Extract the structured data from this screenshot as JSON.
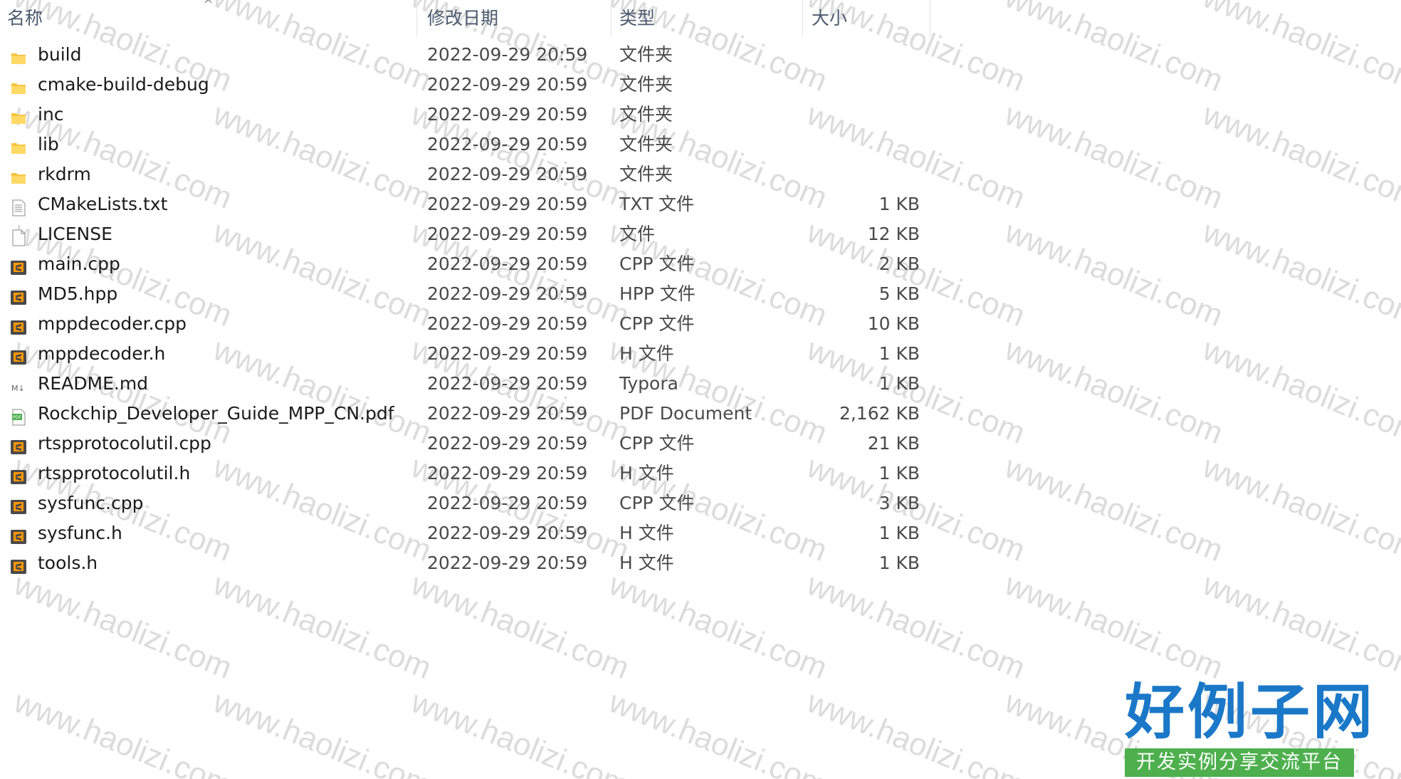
{
  "columns": {
    "name": "名称",
    "modified": "修改日期",
    "type": "类型",
    "size": "大小"
  },
  "files": [
    {
      "name": "build",
      "modified": "2022-09-29 20:59",
      "type": "文件夹",
      "size": "",
      "icon": "folder-icon"
    },
    {
      "name": "cmake-build-debug",
      "modified": "2022-09-29 20:59",
      "type": "文件夹",
      "size": "",
      "icon": "folder-icon"
    },
    {
      "name": "inc",
      "modified": "2022-09-29 20:59",
      "type": "文件夹",
      "size": "",
      "icon": "folder-icon"
    },
    {
      "name": "lib",
      "modified": "2022-09-29 20:59",
      "type": "文件夹",
      "size": "",
      "icon": "folder-icon"
    },
    {
      "name": "rkdrm",
      "modified": "2022-09-29 20:59",
      "type": "文件夹",
      "size": "",
      "icon": "folder-icon"
    },
    {
      "name": "CMakeLists.txt",
      "modified": "2022-09-29 20:59",
      "type": "TXT 文件",
      "size": "1 KB",
      "icon": "text-file-icon"
    },
    {
      "name": "LICENSE",
      "modified": "2022-09-29 20:59",
      "type": "文件",
      "size": "12 KB",
      "icon": "blank-file-icon"
    },
    {
      "name": "main.cpp",
      "modified": "2022-09-29 20:59",
      "type": "CPP 文件",
      "size": "2 KB",
      "icon": "sublime-file-icon"
    },
    {
      "name": "MD5.hpp",
      "modified": "2022-09-29 20:59",
      "type": "HPP 文件",
      "size": "5 KB",
      "icon": "sublime-file-icon"
    },
    {
      "name": "mppdecoder.cpp",
      "modified": "2022-09-29 20:59",
      "type": "CPP 文件",
      "size": "10 KB",
      "icon": "sublime-file-icon"
    },
    {
      "name": "mppdecoder.h",
      "modified": "2022-09-29 20:59",
      "type": "H 文件",
      "size": "1 KB",
      "icon": "sublime-file-icon"
    },
    {
      "name": "README.md",
      "modified": "2022-09-29 20:59",
      "type": "Typora",
      "size": "1 KB",
      "icon": "markdown-file-icon"
    },
    {
      "name": "Rockchip_Developer_Guide_MPP_CN.pdf",
      "modified": "2022-09-29 20:59",
      "type": "PDF Document",
      "size": "2,162 KB",
      "icon": "pdf-file-icon"
    },
    {
      "name": "rtspprotocolutil.cpp",
      "modified": "2022-09-29 20:59",
      "type": "CPP 文件",
      "size": "21 KB",
      "icon": "sublime-file-icon"
    },
    {
      "name": "rtspprotocolutil.h",
      "modified": "2022-09-29 20:59",
      "type": "H 文件",
      "size": "1 KB",
      "icon": "sublime-file-icon"
    },
    {
      "name": "sysfunc.cpp",
      "modified": "2022-09-29 20:59",
      "type": "CPP 文件",
      "size": "3 KB",
      "icon": "sublime-file-icon"
    },
    {
      "name": "sysfunc.h",
      "modified": "2022-09-29 20:59",
      "type": "H 文件",
      "size": "1 KB",
      "icon": "sublime-file-icon"
    },
    {
      "name": "tools.h",
      "modified": "2022-09-29 20:59",
      "type": "H 文件",
      "size": "1 KB",
      "icon": "sublime-file-icon"
    }
  ],
  "watermark": "www.haolizi.com",
  "logo": {
    "title": "好例子网",
    "subtitle": "开发实例分享交流平台"
  },
  "colors": {
    "folder": "#f5c542",
    "sublime": "#ff9800",
    "header_text": "#4a5a6e",
    "logo_blue": "#1b78c8",
    "logo_green": "#4db04d"
  }
}
